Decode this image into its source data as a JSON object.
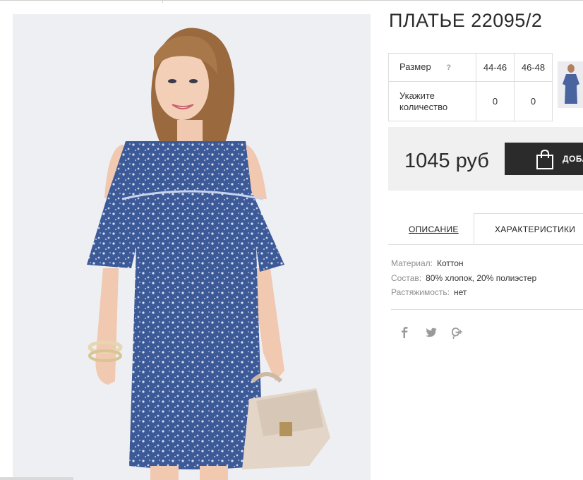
{
  "product": {
    "title": "ПЛАТЬЕ 22095/2",
    "price": "1045 руб",
    "buy_button": "ДОБАВИТЬ В КОРЗИНУ",
    "photo_icon": "dress-photo",
    "thumbnail_icon": "dress-thumbnail"
  },
  "size_table": {
    "size_label": "Размер",
    "help": "?",
    "sizes": [
      "44-46",
      "46-48"
    ],
    "qty_label_line1": "Укажите",
    "qty_label_line2": "количество",
    "quantities": [
      "0",
      "0"
    ]
  },
  "tabs": [
    {
      "label": "ОПИСАНИЕ",
      "active": false
    },
    {
      "label": "ХАРАКТЕРИСТИКИ",
      "active": true
    }
  ],
  "characteristics": [
    {
      "key": "Материал:",
      "value": "Коттон"
    },
    {
      "key": "Состав:",
      "value": "80% хлопок, 20% полиэстер"
    },
    {
      "key": "Растяжимость:",
      "value": "нет"
    }
  ],
  "social": [
    {
      "name": "facebook",
      "glyph": "f"
    },
    {
      "name": "twitter",
      "glyph": "t"
    },
    {
      "name": "google-plus",
      "glyph": "g+"
    }
  ],
  "colors": {
    "dress": "#3d5a98",
    "button": "#2b2b2b",
    "price_box": "#f0f0f0",
    "photo_bg": "#eeeff3"
  }
}
